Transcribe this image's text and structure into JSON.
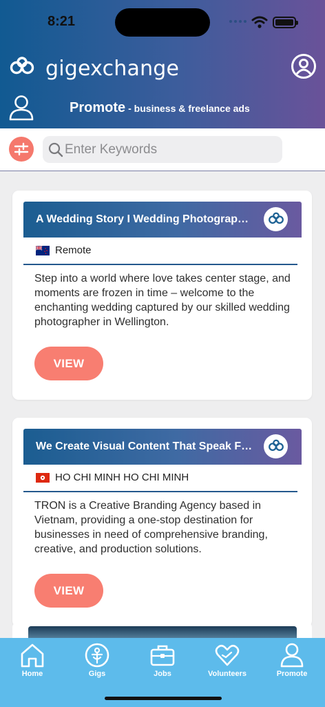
{
  "status_bar": {
    "time": "8:21"
  },
  "header": {
    "logo_text": "gigexchange",
    "page_title": "Promote",
    "page_subtitle": "- business & freelance ads"
  },
  "search": {
    "placeholder": "Enter Keywords",
    "value": ""
  },
  "listings": [
    {
      "title": "A Wedding Story I Wedding Photographer in Wellington",
      "location": "Remote",
      "flag": "NZ",
      "description": "Step into a world where love takes center stage, and moments are frozen in time – welcome to the enchanting wedding captured by our skilled wedding photographer in Wellington.",
      "button": "VIEW"
    },
    {
      "title": "We Create Visual Content That Speak For Your Brand",
      "location": "HO CHI MINH HO CHI MINH",
      "flag": "HK",
      "description": "TRON is a Creative Branding Agency based in Vietnam, providing a one-stop destination for businesses in need of comprehensive branding, creative, and production solutions.",
      "button": "VIEW"
    }
  ],
  "tabs": [
    {
      "label": "Home",
      "icon": "home-icon"
    },
    {
      "label": "Gigs",
      "icon": "gigs-icon"
    },
    {
      "label": "Jobs",
      "icon": "briefcase-icon"
    },
    {
      "label": "Volunteers",
      "icon": "heart-hands-icon"
    },
    {
      "label": "Promote",
      "icon": "person-icon"
    }
  ],
  "colors": {
    "header_start": "#115a92",
    "header_end": "#6a5299",
    "accent": "#f87e71",
    "tabbar": "#5dbbeb"
  }
}
